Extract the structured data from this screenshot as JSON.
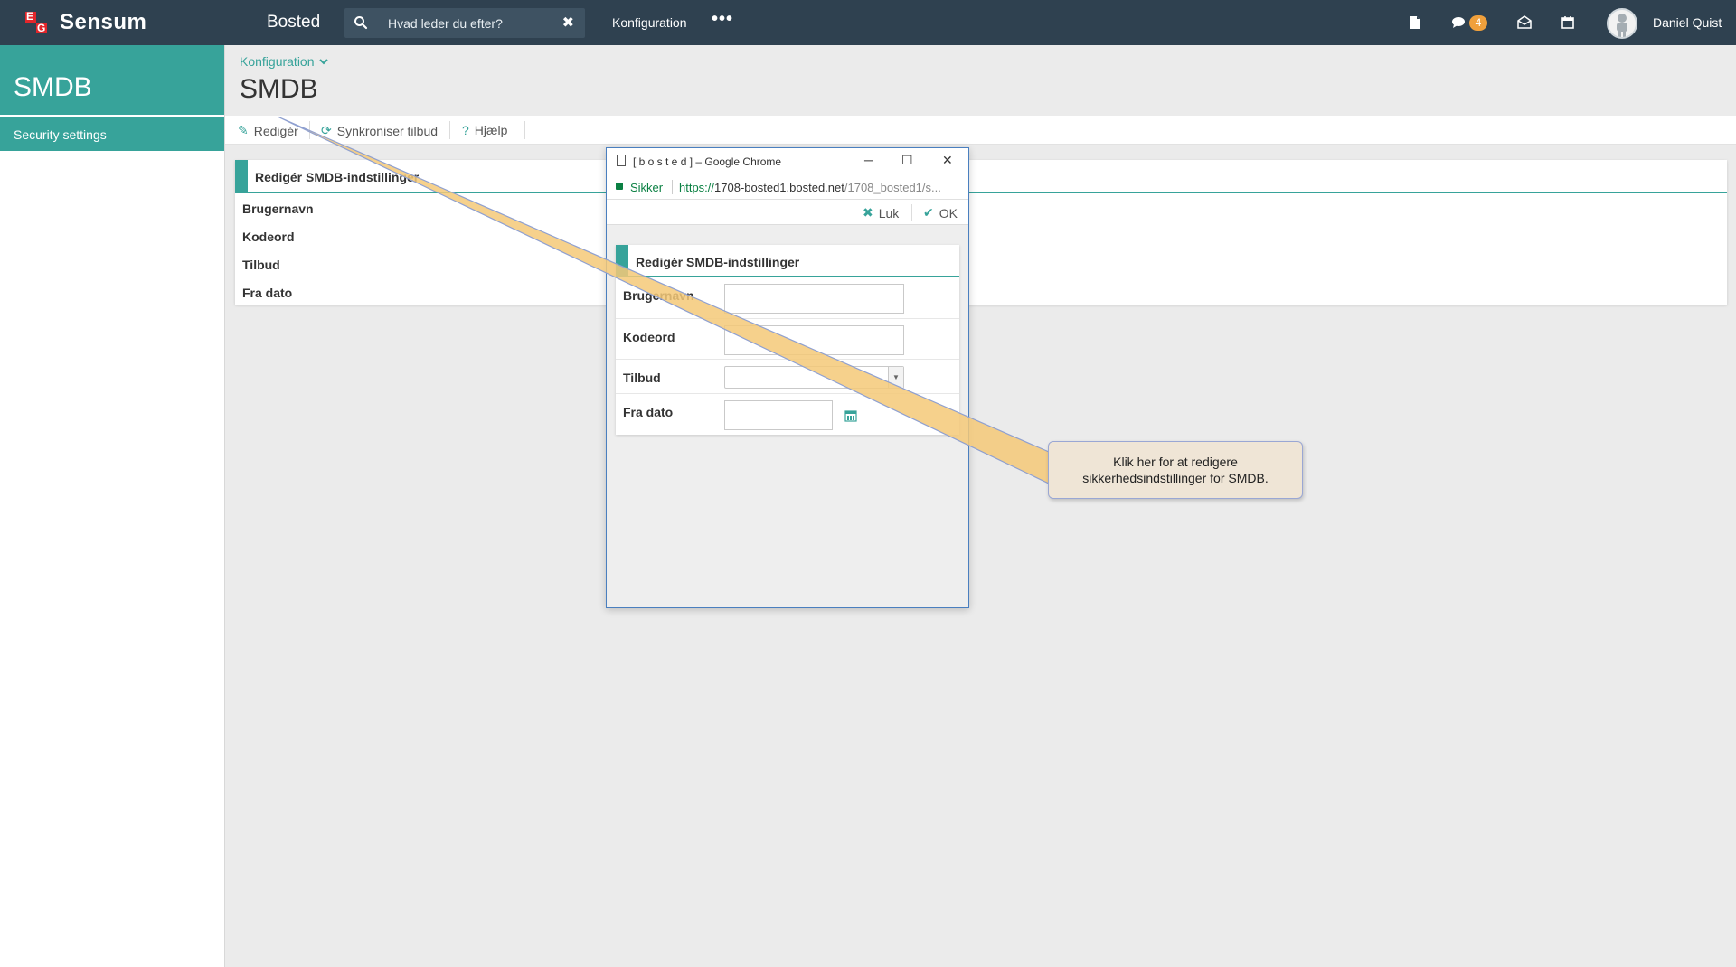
{
  "topbar": {
    "brand": "Sensum",
    "logo_letters": [
      "E",
      "G"
    ],
    "title": "Bosted",
    "search_placeholder": "Hvad leder du efter?",
    "config_link": "Konfiguration",
    "more": "•••",
    "chat_badge": "4",
    "user_name": "Daniel Quist",
    "icons": [
      "document-icon",
      "chat-icon",
      "mail-icon",
      "calendar-icon",
      "avatar"
    ]
  },
  "sidebar": {
    "heading": "SMDB",
    "items": [
      {
        "label": "Security settings"
      }
    ]
  },
  "content": {
    "breadcrumb": "Konfiguration",
    "title": "SMDB",
    "toolbar": {
      "edit": "Redigér",
      "sync": "Synkroniser tilbud",
      "help": "Hjælp"
    },
    "panel": {
      "heading": "Redigér SMDB-indstillinger",
      "rows": [
        "Brugernavn",
        "Kodeord",
        "Tilbud",
        "Fra dato"
      ]
    }
  },
  "popup": {
    "window_title": "[ b o s t e d ] – Google Chrome",
    "secure_label": "Sikker",
    "url_scheme": "https://",
    "url_host": "1708-bosted1.bosted.net",
    "url_path": "/1708_bosted1/s...",
    "close_label": "Luk",
    "ok_label": "OK",
    "form": {
      "heading": "Redigér SMDB-indstillinger",
      "username_label": "Brugernavn",
      "password_label": "Kodeord",
      "offer_label": "Tilbud",
      "from_date_label": "Fra dato"
    }
  },
  "callout": {
    "line1": "Klik her for at redigere",
    "line2": "sikkerhedsindstillinger for SMDB."
  },
  "colors": {
    "topbar": "#2f4150",
    "accent": "#37a39a",
    "badge": "#f0a03c",
    "callout": "#efe5d6"
  }
}
